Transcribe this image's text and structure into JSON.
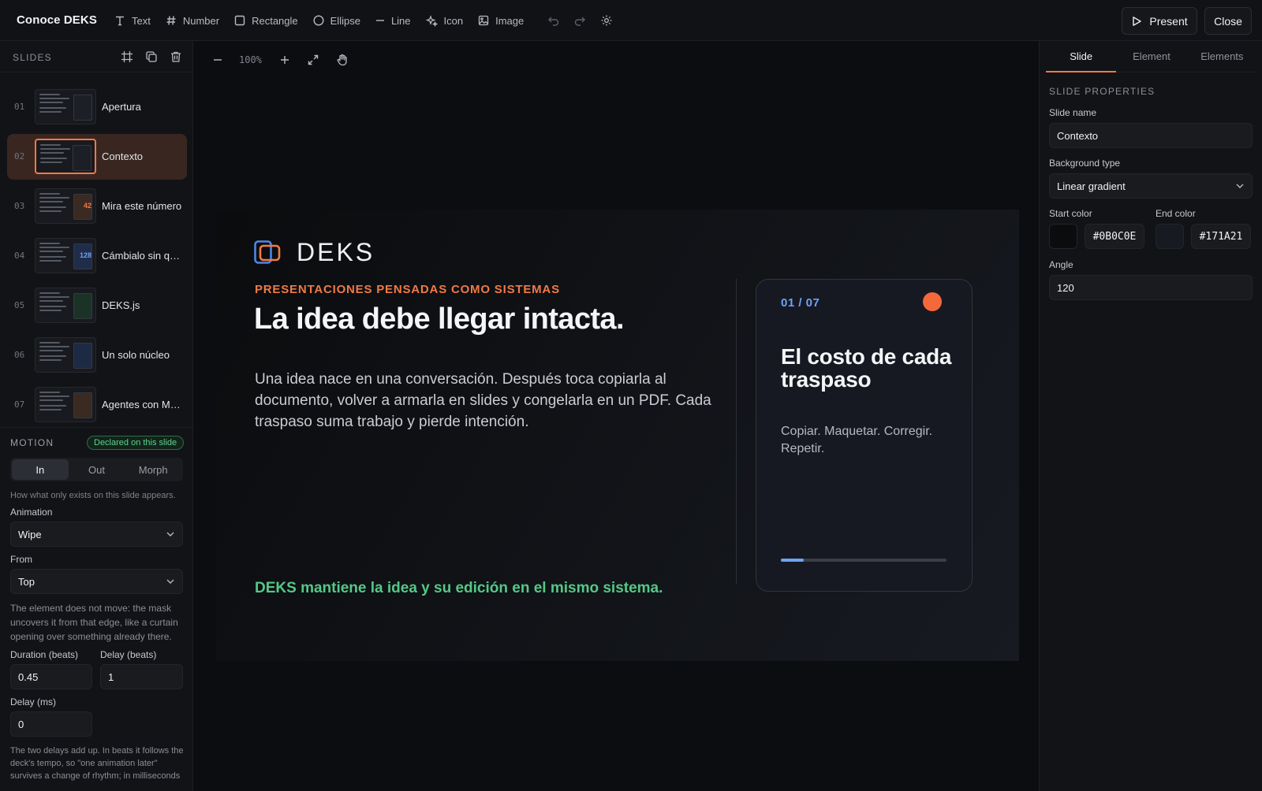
{
  "app": {
    "title": "Conoce DEKS"
  },
  "toolbar": {
    "tools": [
      {
        "label": "Text",
        "icon": "text-icon"
      },
      {
        "label": "Number",
        "icon": "hash-icon"
      },
      {
        "label": "Rectangle",
        "icon": "rectangle-icon"
      },
      {
        "label": "Ellipse",
        "icon": "ellipse-icon"
      },
      {
        "label": "Line",
        "icon": "line-icon"
      },
      {
        "label": "Icon",
        "icon": "sparkle-icon"
      },
      {
        "label": "Image",
        "icon": "image-icon"
      }
    ],
    "present_label": "Present",
    "close_label": "Close"
  },
  "slides_panel": {
    "label": "SLIDES",
    "items": [
      {
        "num": "01",
        "title": "Apertura"
      },
      {
        "num": "02",
        "title": "Contexto"
      },
      {
        "num": "03",
        "title": "Mira este número",
        "badge": "42"
      },
      {
        "num": "04",
        "title": "Cámbialo sin quitar el ritmo",
        "badge": "128"
      },
      {
        "num": "05",
        "title": "DEKS.js"
      },
      {
        "num": "06",
        "title": "Un solo núcleo"
      },
      {
        "num": "07",
        "title": "Agentes con MCP"
      }
    ],
    "active_index": 1
  },
  "motion": {
    "label": "MOTION",
    "declared": "Declared on this slide",
    "tabs": [
      "In",
      "Out",
      "Morph"
    ],
    "active_tab": "In",
    "hint": "How what only exists on this slide appears.",
    "animation_label": "Animation",
    "animation_value": "Wipe",
    "from_label": "From",
    "from_value": "Top",
    "from_hint": "The element does not move: the mask uncovers it from that edge, like a curtain opening over something already there.",
    "duration_label": "Duration (beats)",
    "duration_value": "0.45",
    "delay_beats_label": "Delay (beats)",
    "delay_beats_value": "1",
    "delay_ms_label": "Delay (ms)",
    "delay_ms_value": "0",
    "delays_hint": "The two delays add up. In beats it follows the deck's tempo, so \"one animation later\" survives a change of rhythm; in milliseconds"
  },
  "canvas": {
    "zoom": "100%",
    "slide": {
      "logo_text": "DEKS",
      "eyebrow": "PRESENTACIONES PENSADAS COMO SISTEMAS",
      "headline": "La idea debe llegar intacta.",
      "body": "Una idea nace en una conversación. Después toca copiarla al documento, volver a armarla en slides y congelarla en un PDF. Cada traspaso suma trabajo y pierde intención.",
      "bottom_line": "DEKS mantiene la idea y su edición en el mismo sistema.",
      "card": {
        "counter": "01 / 07",
        "title": "El costo de cada traspaso",
        "subtitle": "Copiar. Maquetar. Corregir. Repetir.",
        "progress": 0.14
      }
    }
  },
  "properties": {
    "tabs": [
      "Slide",
      "Element",
      "Elements"
    ],
    "active_tab": "Slide",
    "section_label": "SLIDE PROPERTIES",
    "slide_name_label": "Slide name",
    "slide_name_value": "Contexto",
    "bg_type_label": "Background type",
    "bg_type_value": "Linear gradient",
    "start_color_label": "Start color",
    "start_color_value": "#0B0C0E",
    "end_color_label": "End color",
    "end_color_value": "#171A21",
    "angle_label": "Angle",
    "angle_value": "120"
  },
  "colors": {
    "accent": "#f07a45",
    "blue": "#6fa2f6",
    "green": "#55c887",
    "dot": "#f4683c"
  }
}
